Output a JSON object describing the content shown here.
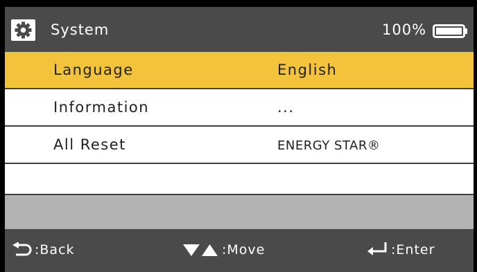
{
  "header": {
    "title": "System",
    "battery_percent": "100%",
    "battery_level": 1.0,
    "icons": {
      "settings": "gear-icon",
      "battery": "battery-icon"
    }
  },
  "menu": {
    "items": [
      {
        "label": "Language",
        "value": "English",
        "selected": true
      },
      {
        "label": "Information",
        "value": "...",
        "selected": false
      },
      {
        "label": "All Reset",
        "value": "ENERGY STAR®",
        "selected": false
      },
      {
        "label": "",
        "value": "",
        "selected": false
      }
    ]
  },
  "footer": {
    "back_label": ":Back",
    "move_label": ":Move",
    "enter_label": ":Enter",
    "icons": {
      "back": "back-arrow-icon",
      "move": "up-down-triangles-icon",
      "enter": "enter-return-icon"
    }
  },
  "colors": {
    "header_bg": "#4a4a4a",
    "selected_row": "#f3c33b",
    "grey_band": "#b3b3b3",
    "text": "#1f1f1f"
  }
}
